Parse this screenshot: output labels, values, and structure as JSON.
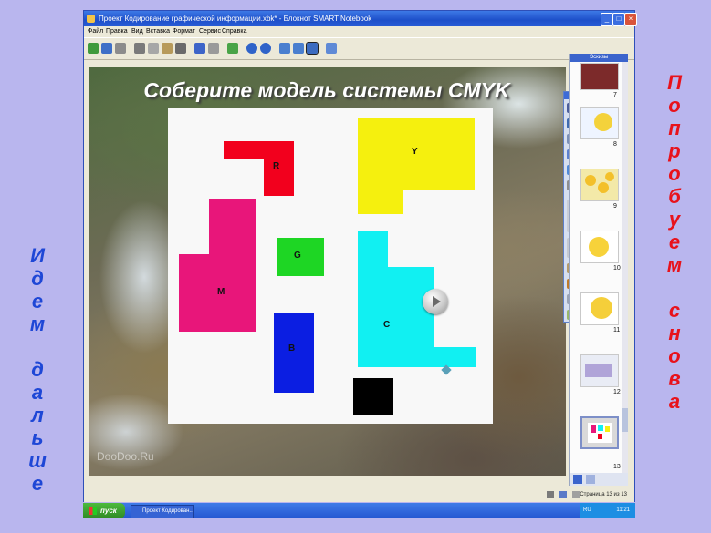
{
  "left_word": [
    "И",
    "д",
    "е",
    "м",
    "",
    "д",
    "а",
    "л",
    "ь",
    "ш",
    "е"
  ],
  "right_word": [
    "П",
    "о",
    "п",
    "р",
    "о",
    "б",
    "у",
    "е",
    "м",
    "",
    "с",
    "н",
    "о",
    "в",
    "а"
  ],
  "window": {
    "title": "Проект Кодирование графической информации.xbk* - Блокнот SMART Notebook",
    "min_icon": "minimize-icon",
    "max_icon": "maximize-icon",
    "close_icon": "close-icon"
  },
  "menu": [
    "Файл",
    "Правка",
    "Вид",
    "Вставка",
    "Формат",
    "Сервис",
    "Справка"
  ],
  "slide": {
    "title": "Соберите модель системы CMYK",
    "watermark": "DooDoo.Ru",
    "pieces": {
      "red": "R",
      "yellow": "Y",
      "magenta": "M",
      "green": "G",
      "blue": "B",
      "cyan": "C"
    }
  },
  "sidebar": {
    "header": "Эскизы",
    "thumbs": [
      "7",
      "8",
      "9",
      "10",
      "11",
      "12",
      "13"
    ]
  },
  "statusbar": {
    "page_text": "Страница 13 из 13"
  },
  "taskbar": {
    "start": "пуск",
    "task": "Проект Кодирован...",
    "lang": "RU",
    "clock": "11:21"
  },
  "colors": {
    "left_word": "#1e47d6",
    "right_word": "#e8121b",
    "background": "#b9b6ee"
  }
}
